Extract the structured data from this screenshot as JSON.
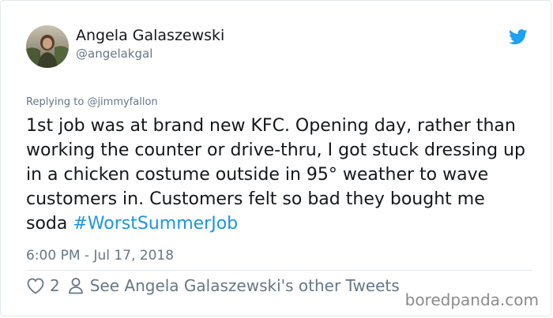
{
  "author": {
    "name": "Angela Galaszewski",
    "handle": "@angelakgal"
  },
  "reply": {
    "prefix": "Replying to",
    "mention": "@jimmyfallon"
  },
  "tweet": {
    "text": "1st job was at brand new KFC. Opening day, rather than working the counter or drive-thru, I got stuck dressing up in a chicken costume outside in 95° weather to wave customers in. Customers felt so bad they bought me soda ",
    "hashtag": "#WorstSummerJob",
    "timestamp": "6:00 PM - Jul 17, 2018"
  },
  "actions": {
    "like_count": "2",
    "profile_link": "See Angela Galaszewski's other Tweets"
  },
  "watermark": "boredpanda.com",
  "colors": {
    "twitter_blue": "#1da1f2",
    "hashtag_blue": "#1b95e0",
    "secondary_text": "#657786",
    "primary_text": "#14171a",
    "divider": "#e1e8ed"
  },
  "icons": {
    "brand": "twitter-bird-icon",
    "like": "heart-icon",
    "profile": "person-icon"
  }
}
